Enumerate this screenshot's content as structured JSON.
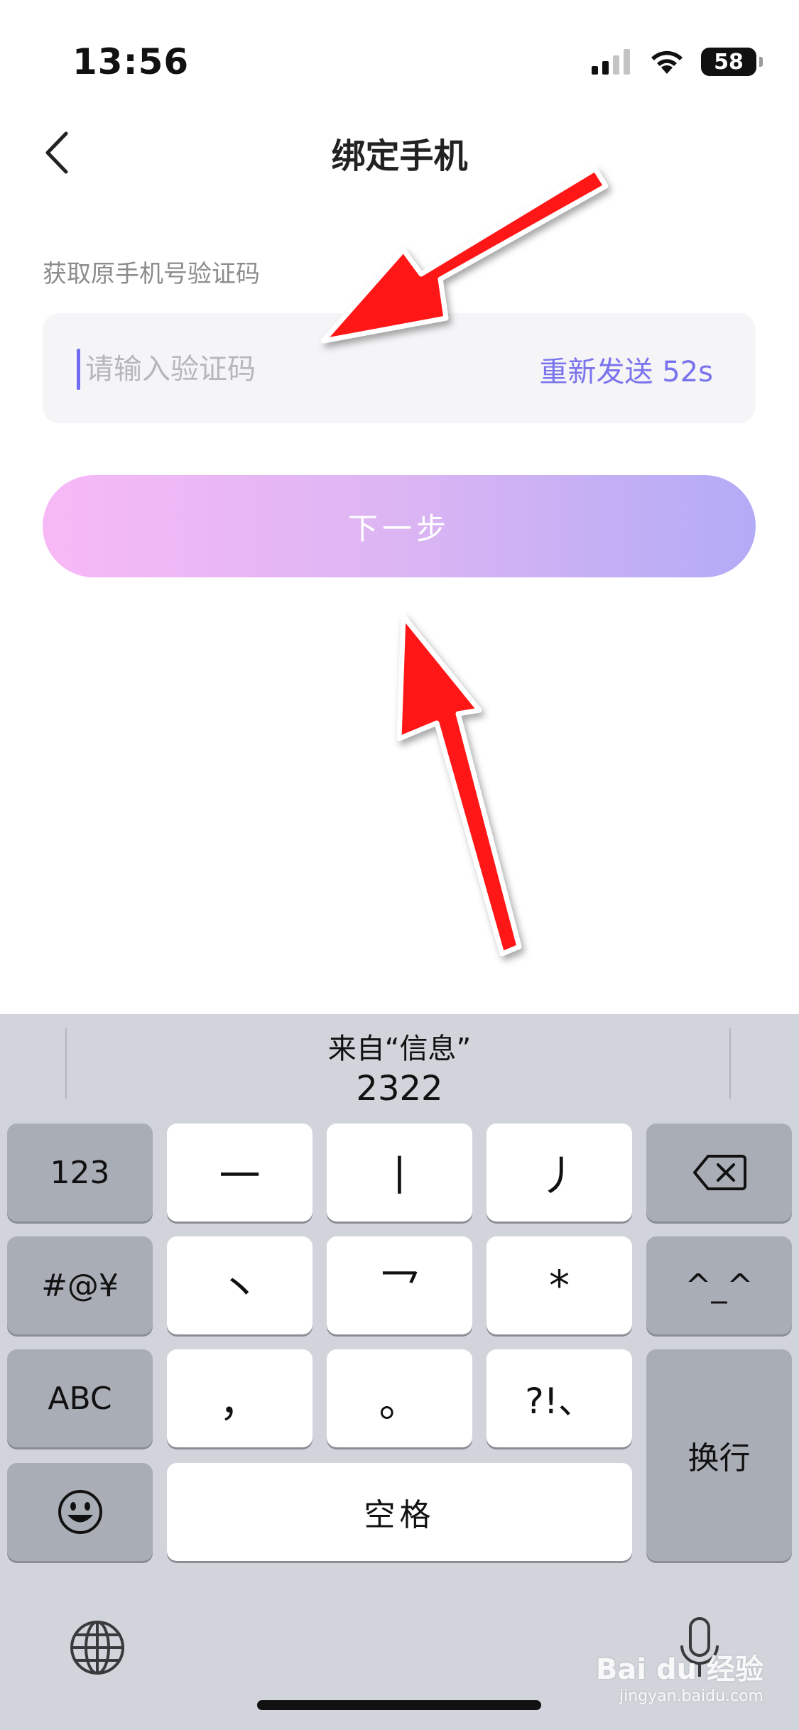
{
  "status_bar": {
    "time": "13:56",
    "battery": "58"
  },
  "nav": {
    "title": "绑定手机"
  },
  "form": {
    "subtitle": "获取原手机号验证码",
    "code_placeholder": "请输入验证码",
    "resend_label": "重新发送 52s",
    "next_label": "下一步"
  },
  "keyboard": {
    "suggestion_label": "来自“信息”",
    "suggestion_code": "2322",
    "keys": {
      "num": "123",
      "stroke1": "一",
      "stroke2": "丨",
      "stroke3": "丿",
      "sym": "#@¥",
      "stroke4": "丶",
      "stroke5": "乛",
      "star": "*",
      "emoticon": "^_^",
      "abc": "ABC",
      "comma": "，",
      "period": "。",
      "punct": "?!、",
      "return": "换行",
      "space": "空格"
    }
  },
  "watermark": {
    "brand": "Bai du 经验",
    "url": "jingyan.baidu.com"
  },
  "colors": {
    "accent": "#7a73ee",
    "gradient_start": "#f7b9f6",
    "gradient_end": "#b3abf6",
    "arrow": "#ff1414"
  }
}
